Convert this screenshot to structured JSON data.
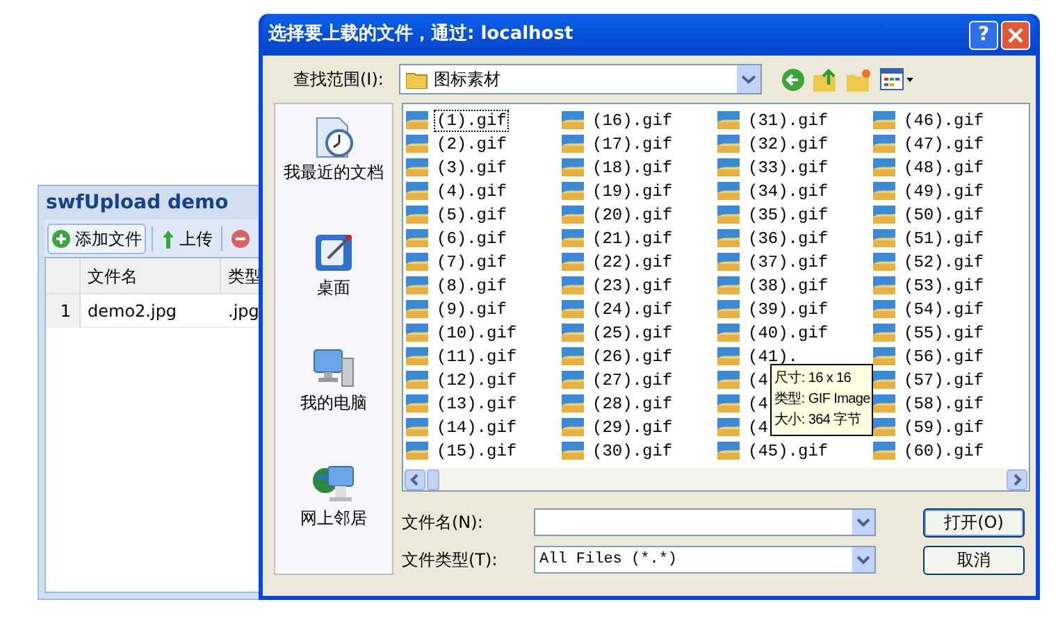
{
  "back_window": {
    "title": "swfUpload demo",
    "toolbar": [
      {
        "kind": "add",
        "label": "添加文件"
      },
      {
        "kind": "upload",
        "label": "上传"
      },
      {
        "kind": "remove"
      }
    ],
    "columns": [
      "文件名",
      "类型"
    ],
    "rows": [
      {
        "index": "1",
        "cells": [
          "demo2.jpg",
          ".jpg"
        ]
      }
    ]
  },
  "dialog": {
    "title": "选择要上载的文件，通过: localhost",
    "help": "?",
    "look_in": {
      "label": "查找范围(I):",
      "value": "图标素材"
    },
    "places": [
      {
        "kind": "recent",
        "label": "我最近的文档"
      },
      {
        "kind": "desktop",
        "label": "桌面"
      },
      {
        "kind": "computer",
        "label": "我的电脑"
      },
      {
        "kind": "network",
        "label": "网上邻居"
      }
    ],
    "files": [
      {
        "name": "(1).gif",
        "focused": true
      },
      {
        "name": "(2).gif",
        "focused": false
      },
      {
        "name": "(3).gif",
        "focused": false
      },
      {
        "name": "(4).gif",
        "focused": false
      },
      {
        "name": "(5).gif",
        "focused": false
      },
      {
        "name": "(6).gif",
        "focused": false
      },
      {
        "name": "(7).gif",
        "focused": false
      },
      {
        "name": "(8).gif",
        "focused": false
      },
      {
        "name": "(9).gif",
        "focused": false
      },
      {
        "name": "(10).gif",
        "focused": false
      },
      {
        "name": "(11).gif",
        "focused": false
      },
      {
        "name": "(12).gif",
        "focused": false
      },
      {
        "name": "(13).gif",
        "focused": false
      },
      {
        "name": "(14).gif",
        "focused": false
      },
      {
        "name": "(15).gif",
        "focused": false
      },
      {
        "name": "(16).gif",
        "focused": false
      },
      {
        "name": "(17).gif",
        "focused": false
      },
      {
        "name": "(18).gif",
        "focused": false
      },
      {
        "name": "(19).gif",
        "focused": false
      },
      {
        "name": "(20).gif",
        "focused": false
      },
      {
        "name": "(21).gif",
        "focused": false
      },
      {
        "name": "(22).gif",
        "focused": false
      },
      {
        "name": "(23).gif",
        "focused": false
      },
      {
        "name": "(24).gif",
        "focused": false
      },
      {
        "name": "(25).gif",
        "focused": false
      },
      {
        "name": "(26).gif",
        "focused": false
      },
      {
        "name": "(27).gif",
        "focused": false
      },
      {
        "name": "(28).gif",
        "focused": false
      },
      {
        "name": "(29).gif",
        "focused": false
      },
      {
        "name": "(30).gif",
        "focused": false
      },
      {
        "name": "(31).gif",
        "focused": false
      },
      {
        "name": "(32).gif",
        "focused": false
      },
      {
        "name": "(33).gif",
        "focused": false
      },
      {
        "name": "(34).gif",
        "focused": false
      },
      {
        "name": "(35).gif",
        "focused": false
      },
      {
        "name": "(36).gif",
        "focused": false
      },
      {
        "name": "(37).gif",
        "focused": false
      },
      {
        "name": "(38).gif",
        "focused": false
      },
      {
        "name": "(39).gif",
        "focused": false
      },
      {
        "name": "(40).gif",
        "focused": false
      },
      {
        "name": "(41).",
        "focused": false
      },
      {
        "name": "(4",
        "focused": false
      },
      {
        "name": "(4",
        "focused": false
      },
      {
        "name": "(4",
        "focused": false
      },
      {
        "name": "(45).gif",
        "focused": false
      },
      {
        "name": "(46).gif",
        "focused": false
      },
      {
        "name": "(47).gif",
        "focused": false
      },
      {
        "name": "(48).gif",
        "focused": false
      },
      {
        "name": "(49).gif",
        "focused": false
      },
      {
        "name": "(50).gif",
        "focused": false
      },
      {
        "name": "(51).gif",
        "focused": false
      },
      {
        "name": "(52).gif",
        "focused": false
      },
      {
        "name": "(53).gif",
        "focused": false
      },
      {
        "name": "(54).gif",
        "focused": false
      },
      {
        "name": "(55).gif",
        "focused": false
      },
      {
        "name": "(56).gif",
        "focused": false
      },
      {
        "name": "(57).gif",
        "focused": false
      },
      {
        "name": "(58).gif",
        "focused": false
      },
      {
        "name": "(59).gif",
        "focused": false
      },
      {
        "name": "(60).gif",
        "focused": false
      }
    ],
    "tooltip": [
      "尺寸: 16 x 16",
      "类型: GIF Image",
      "大小: 364 字节"
    ],
    "file_name": {
      "label": "文件名(N):"
    },
    "file_type": {
      "label": "文件类型(T):",
      "value": "All Files (*.*)"
    },
    "buttons": [
      "打开(O)",
      "取消"
    ]
  }
}
